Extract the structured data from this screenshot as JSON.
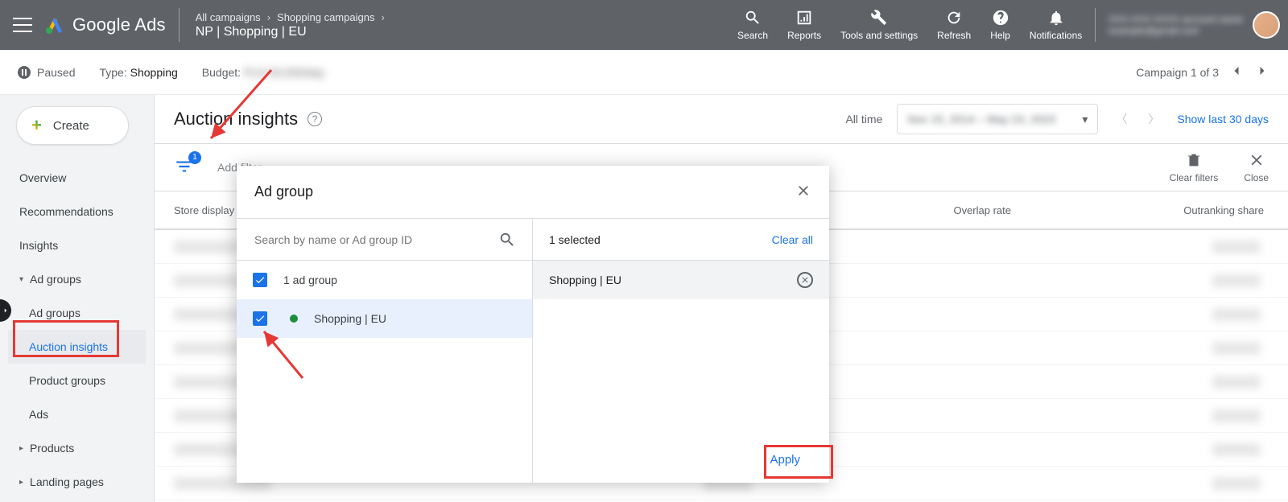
{
  "header": {
    "logo_text": "Google Ads",
    "breadcrumb1": [
      "All campaigns",
      "Shopping campaigns"
    ],
    "breadcrumb2": "NP | Shopping | EU",
    "icons": {
      "search": "Search",
      "reports": "Reports",
      "tools": "Tools and settings",
      "refresh": "Refresh",
      "help": "Help",
      "notifications": "Notifications"
    },
    "account_line1": "XXX-XXX-XXXX account name",
    "account_line2": "example@gmail.com"
  },
  "subheader": {
    "status": "Paused",
    "type_label": "Type: ",
    "type_value": "Shopping",
    "budget_label": "Budget: ",
    "budget_value": "PLN 50,000/day",
    "pager": "Campaign 1 of 3"
  },
  "sidebar": {
    "create": "Create",
    "items": [
      {
        "label": "Overview"
      },
      {
        "label": "Recommendations"
      },
      {
        "label": "Insights"
      },
      {
        "label": "Ad groups",
        "caret": "▾"
      },
      {
        "label": "Ad groups",
        "sub": true
      },
      {
        "label": "Auction insights",
        "sub": true,
        "active": true
      },
      {
        "label": "Product groups",
        "sub": true
      },
      {
        "label": "Ads",
        "sub": true
      },
      {
        "label": "Products",
        "caret": "▸"
      },
      {
        "label": "Landing pages",
        "caret": "▸"
      }
    ]
  },
  "page": {
    "title": "Auction insights",
    "all_time": "All time",
    "date_range": "Nov 15, 2014 – May 23, 2023",
    "show_last": "Show last 30 days"
  },
  "filter": {
    "badge": "1",
    "add_filter": "Add filter",
    "clear_filters": "Clear filters",
    "close": "Close"
  },
  "table": {
    "col_store": "Store display n",
    "col_overlap": "Overlap rate",
    "col_outrank": "Outranking share"
  },
  "popup": {
    "title": "Ad group",
    "search_placeholder": "Search by name or Ad group ID",
    "all_label": "1 ad group",
    "item_label": "Shopping | EU",
    "selected_count": "1 selected",
    "clear_all": "Clear all",
    "selected_item": "Shopping | EU",
    "apply": "Apply"
  }
}
